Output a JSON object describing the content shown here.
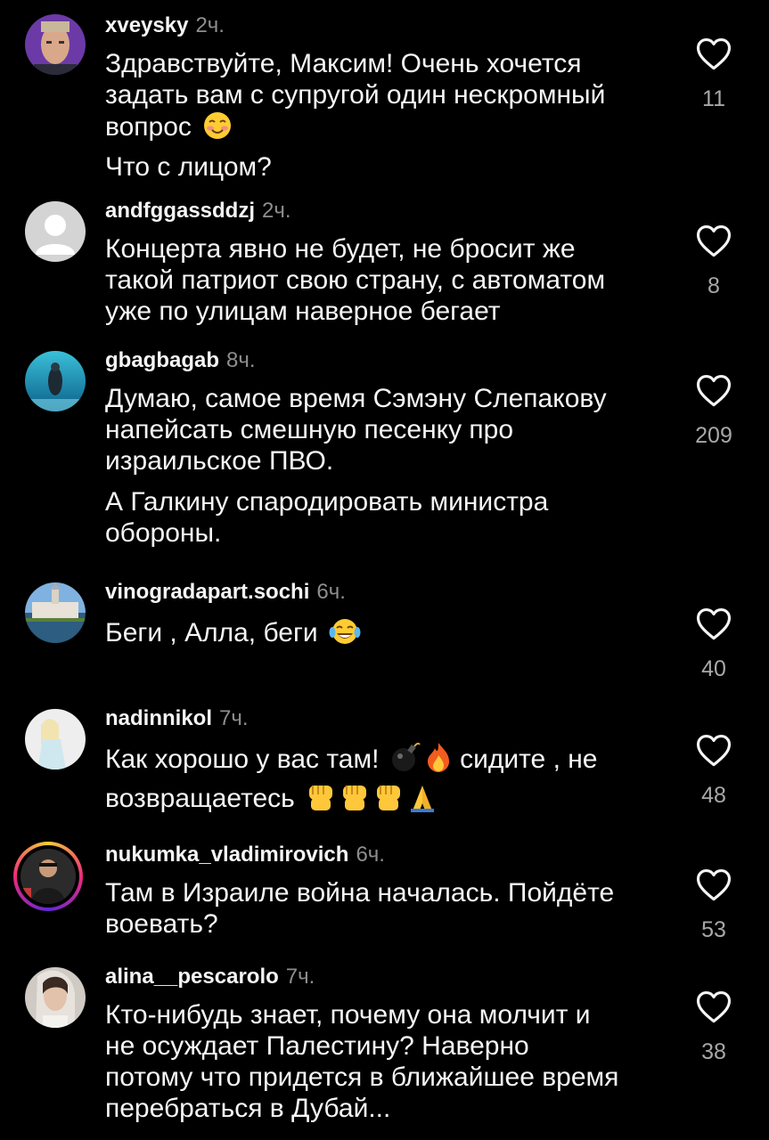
{
  "comments": [
    {
      "username": "xveysky",
      "time": "2ч.",
      "paragraphs": [
        "Здравствуйте, Максим! Очень хочется\nзадать вам с супругой один нескромный\nвопрос",
        "Что с лицом?"
      ],
      "likes": "11",
      "emoji": [
        "smiling-face-with-blush"
      ]
    },
    {
      "username": "andfggassddzj",
      "time": "2ч.",
      "paragraphs": [
        "Концерта явно не будет, не бросит же\nтакой патриот свою страну, с автоматом\nуже по улицам наверное бегает"
      ],
      "likes": "8"
    },
    {
      "username": "gbagbagab",
      "time": "8ч.",
      "paragraphs": [
        "Думаю, самое время Сэмэну Слепакову\nнапейсать смешную песенку про\nизраильское ПВО.",
        "А Галкину спародировать министра\nобороны."
      ],
      "likes": "209"
    },
    {
      "username": "vinogradapart.sochi",
      "time": "6ч.",
      "paragraphs": [
        "Беги , Алла, беги"
      ],
      "likes": "40",
      "emoji": [
        "face-with-tears-of-joy"
      ]
    },
    {
      "username": "nadinnikol",
      "time": "7ч.",
      "paragraphs": [
        "Как хорошо у вас там!",
        "сидите , не",
        "возвращаетесь"
      ],
      "likes": "48",
      "emoji": [
        "bomb",
        "fire",
        "raised-fist",
        "raised-fist",
        "raised-fist",
        "folded-hands"
      ]
    },
    {
      "username": "nukumka_vladimirovich",
      "time": "6ч.",
      "paragraphs": [
        "Там в Израиле война началась. Пойдёте\nвоевать?"
      ],
      "likes": "53"
    },
    {
      "username": "alina__pescarolo",
      "time": "7ч.",
      "paragraphs": [
        "Кто-нибудь знает, почему она молчит и\nне осуждает Палестину? Наверно\nпотому что придется в ближайшее время\nперебраться в Дубай..."
      ],
      "likes": "38"
    }
  ],
  "colors": {
    "background": "#000000",
    "text": "#f5f5f5",
    "secondary": "#8e8e8e",
    "like_count": "#a8a8a8"
  },
  "icons": {
    "like": "heart-outline-icon"
  }
}
